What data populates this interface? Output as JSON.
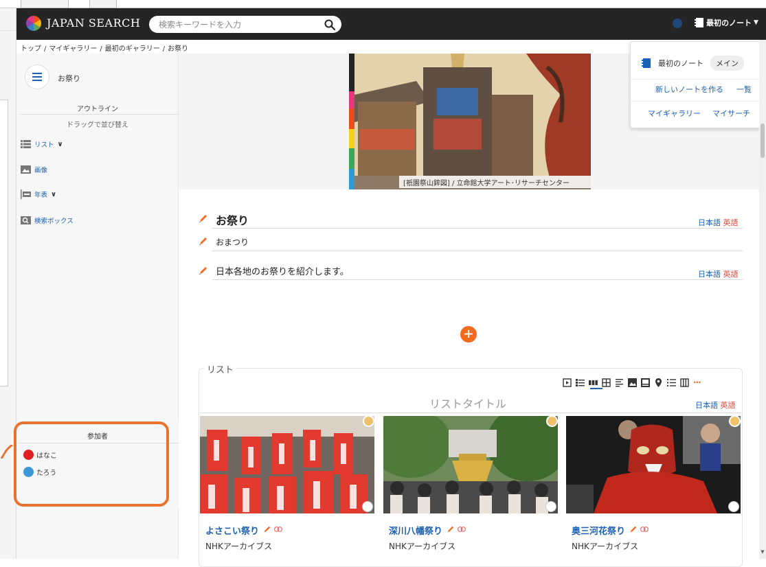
{
  "header": {
    "logo_text": "JAPAN SEARCH",
    "search_placeholder": "検索キーワードを入力",
    "note_menu_label": "最初のノート"
  },
  "breadcrumb": [
    "トップ",
    "マイギャラリー",
    "最初のギャラリー",
    "お祭り"
  ],
  "sidebar": {
    "title": "お祭り",
    "outline_label": "アウトライン",
    "outline_hint": "ドラッグで並び替え",
    "items": [
      {
        "label": "リスト",
        "icon": "list-icon"
      },
      {
        "label": "画像",
        "icon": "image-icon"
      },
      {
        "label": "年表",
        "icon": "timeline-icon"
      },
      {
        "label": "検索ボックス",
        "icon": "search-box-icon"
      }
    ]
  },
  "participants": {
    "title": "参加者",
    "members": [
      {
        "name": "はなこ",
        "color": "#e02020"
      },
      {
        "name": "たろう",
        "color": "#3a9ad9"
      }
    ]
  },
  "hero": {
    "caption": "[祇園祭山鉾図] / 立命館大学アート･リサーチセンター"
  },
  "content": {
    "title": "お祭り",
    "reading": "おまつり",
    "description": "日本各地のお祭りを紹介します。",
    "lang_ja": "日本語",
    "lang_en": "英語"
  },
  "list": {
    "legend": "リスト",
    "title": "リストタイトル",
    "lang_ja": "日本語",
    "lang_en": "英語",
    "cards": [
      {
        "title": "よさこい祭り",
        "source": "NHKアーカイブス"
      },
      {
        "title": "深川八幡祭り",
        "source": "NHKアーカイブス"
      },
      {
        "title": "奥三河花祭り",
        "source": "NHKアーカイブス"
      }
    ]
  },
  "dropdown": {
    "note_name": "最初のノート",
    "main_label": "メイン",
    "new_note": "新しいノートを作る",
    "list_link": "一覧",
    "my_gallery": "マイギャラリー",
    "my_search": "マイサーチ"
  },
  "colors": {
    "accent": "#f26b21",
    "link": "#1d5fb0",
    "highlight": "#e9722e",
    "header_bg": "#252525"
  }
}
